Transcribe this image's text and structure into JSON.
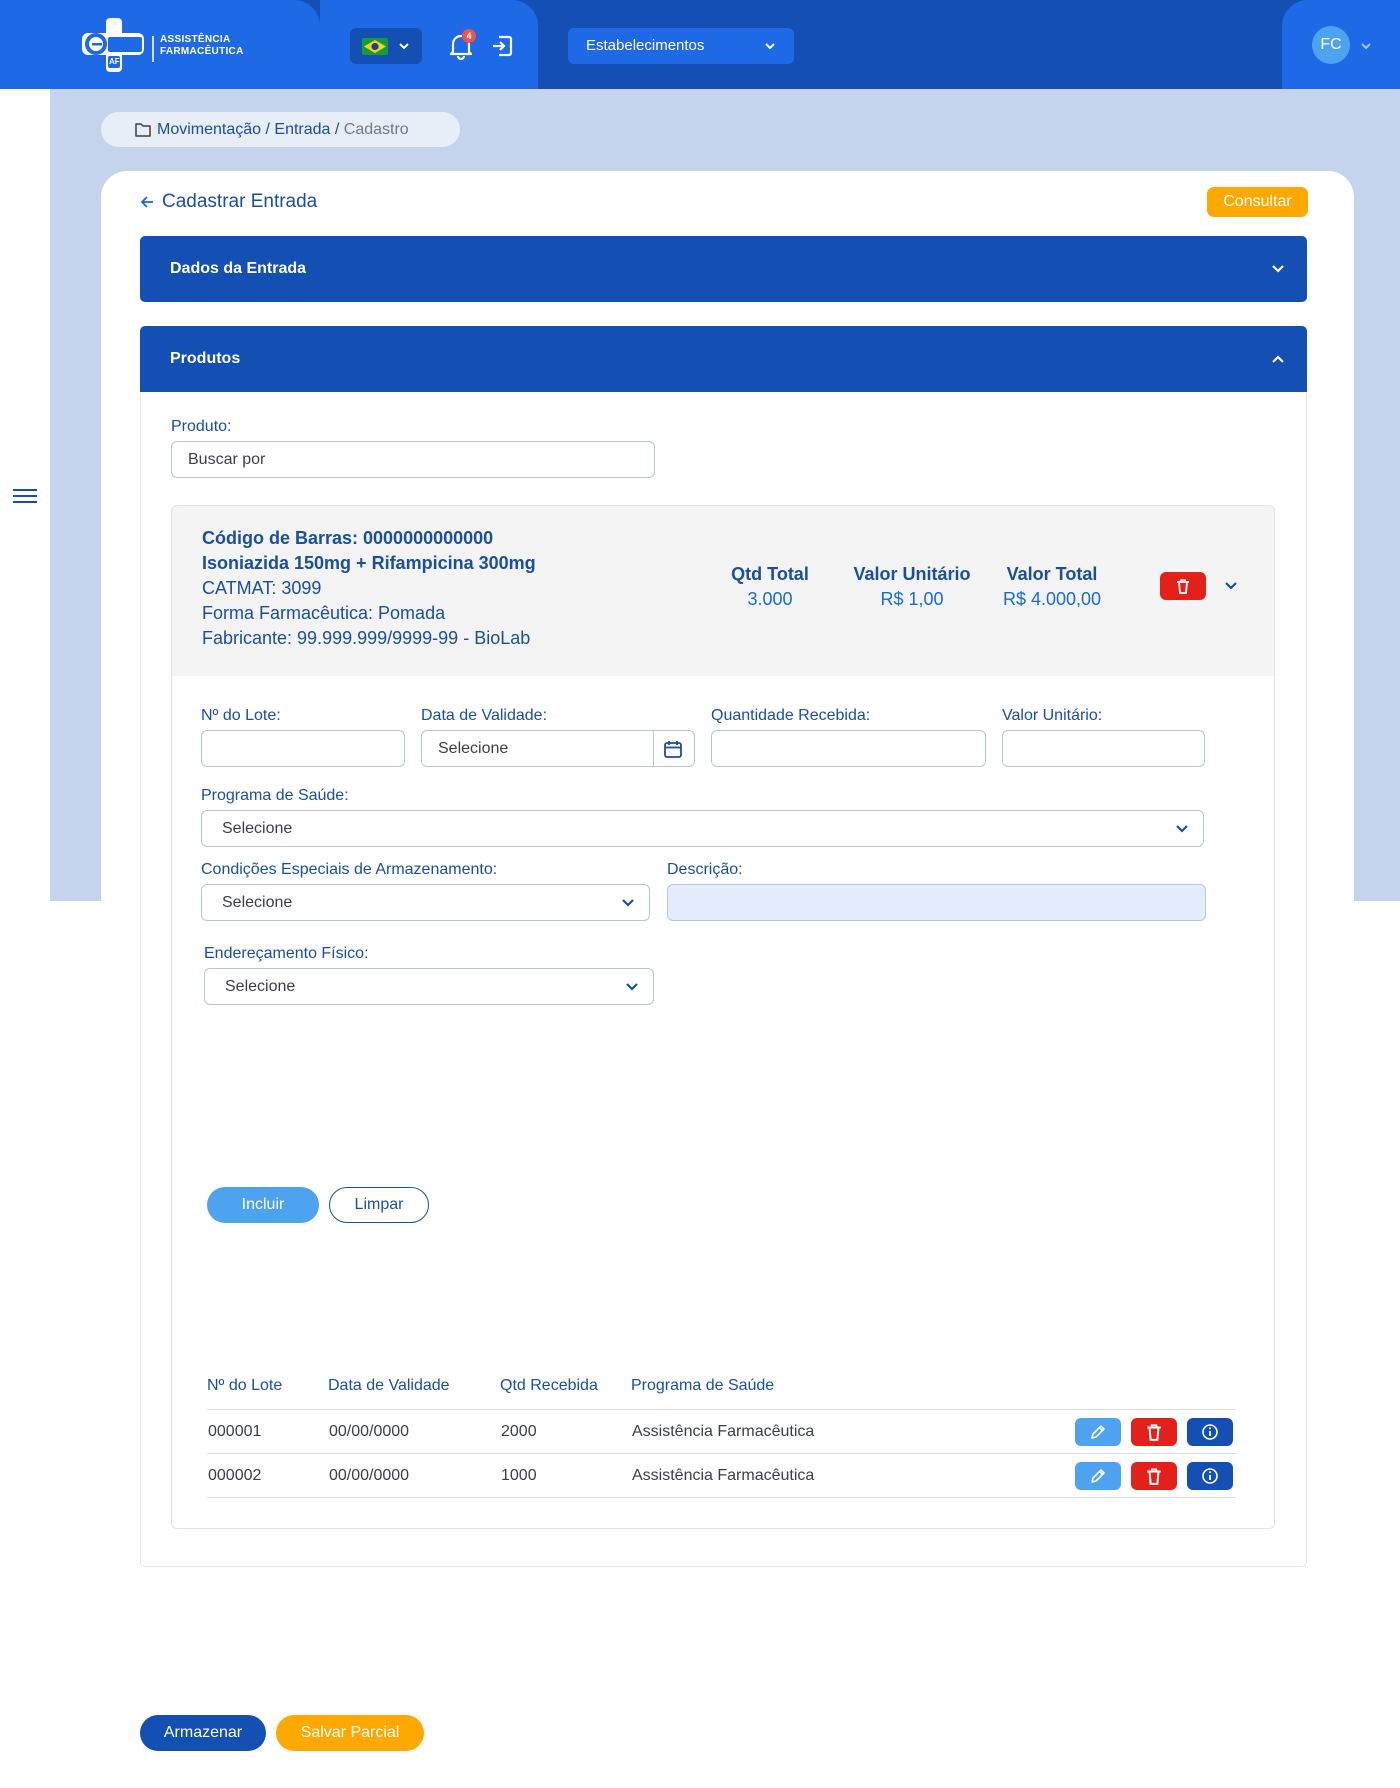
{
  "header": {
    "logo_text": "esus",
    "logo_sub": "AF",
    "logo_title_line1": "ASSISTÊNCIA",
    "logo_title_line2": "FARMACÊUTICA",
    "notifications_count": "4",
    "establishments_label": "Estabelecimentos",
    "user_initials": "FC"
  },
  "breadcrumb": {
    "part1": "Movimentação",
    "sep1": " / ",
    "part2": "Entrada",
    "sep2": " / ",
    "current": "Cadastro"
  },
  "page": {
    "title": "Cadastrar Entrada",
    "consultar_label": "Consultar"
  },
  "sections": {
    "dados": "Dados da Entrada",
    "produtos": "Produtos"
  },
  "produto_search": {
    "label": "Produto:",
    "placeholder": "Buscar por"
  },
  "product": {
    "barcode": "Código de Barras: 0000000000000",
    "name": "Isoniazida 150mg + Rifampicina 300mg",
    "catmat": "CATMAT: 3099",
    "forma": "Forma Farmacêutica: Pomada",
    "fabricante": "Fabricante: 99.999.999/9999-99 - BioLab",
    "qtd_total_label": "Qtd Total",
    "qtd_total_value": "3.000",
    "valor_unitario_label": "Valor Unitário",
    "valor_unitario_value": "R$ 1,00",
    "valor_total_label": "Valor Total",
    "valor_total_value": "R$ 4.000,00"
  },
  "form": {
    "lote_label": "Nº do Lote:",
    "validade_label": "Data de Validade:",
    "validade_value": "Selecione",
    "qtd_recebida_label": "Quantidade Recebida:",
    "valor_unitario_label": "Valor Unitário:",
    "programa_label": "Programa de Saúde:",
    "programa_value": "Selecione",
    "condicoes_label": "Condições Especiais de Armazenamento:",
    "condicoes_value": "Selecione",
    "descricao_label": "Descrição:",
    "enderecamento_label": "Endereçamento Físico:",
    "enderecamento_value": "Selecione",
    "incluir_label": "Incluir",
    "limpar_label": "Limpar"
  },
  "table": {
    "headers": [
      "Nº do Lote",
      "Data de Validade",
      "Qtd Recebida",
      "Programa de Saúde"
    ],
    "rows": [
      {
        "lote": "000001",
        "validade": "00/00/0000",
        "qtd": "2000",
        "programa": "Assistência Farmacêutica"
      },
      {
        "lote": "000002",
        "validade": "00/00/0000",
        "qtd": "1000",
        "programa": "Assistência Farmacêutica"
      }
    ]
  },
  "footer": {
    "armazenar_label": "Armazenar",
    "salvar_label": "Salvar Parcial"
  },
  "colors": {
    "primary": "#1450b4",
    "accent_light": "#4da3ef",
    "warning": "#ffa800",
    "danger": "#e3211a"
  }
}
